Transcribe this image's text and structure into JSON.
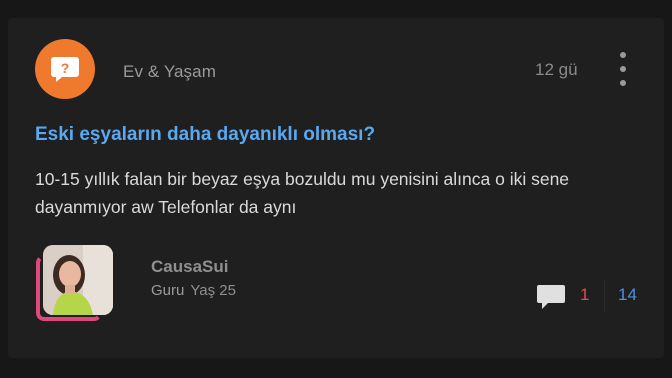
{
  "post": {
    "category": "Ev & Yaşam",
    "time": "12 gü",
    "title": "Eski eşyaların daha dayanıklı olması?",
    "body": "10-15 yıllık falan bir beyaz eşya bozuldu mu yenisini alınca o iki sene dayanmıyor aw Telefonlar da aynı",
    "category_icon": "question-bubble-icon",
    "category_color": "#ef7a2e"
  },
  "author": {
    "name": "CausaSui",
    "rank": "Guru",
    "age": "Yaş 25",
    "ring_color": "#e0487a"
  },
  "stats": {
    "comment_icon": "comment-bubble-icon",
    "red_count": "1",
    "blue_count": "14",
    "red_color": "#e24a5a",
    "blue_color": "#4c8fe0"
  },
  "colors": {
    "background": "#171717",
    "card": "#1f1f1f",
    "title": "#5aa8f0"
  }
}
